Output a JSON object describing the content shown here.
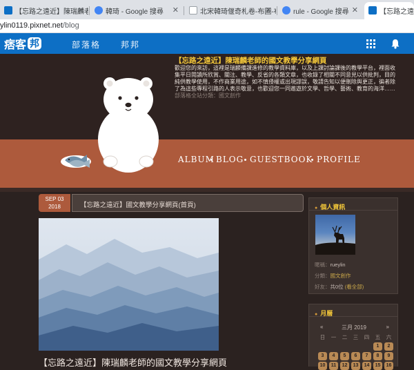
{
  "browser": {
    "tabs": [
      {
        "title": "【忘路之遠近】陳瑞麟老師的國文教學分",
        "active": false,
        "favicon_color": "#0d6fc5"
      },
      {
        "title": "韓琦 - Google 搜尋",
        "active": false,
        "favicon_color": "#4285f4"
      },
      {
        "title": "北宋韓琦偃奇札卷-布圖-布",
        "active": false,
        "favicon_color": "#9aa0a6"
      },
      {
        "title": "rule - Google 搜尋",
        "active": false,
        "favicon_color": "#4285f4"
      },
      {
        "title": "【忘路之遠",
        "active": true,
        "favicon_color": "#0d6fc5"
      }
    ],
    "address": {
      "host": "ylin0119.pixnet.net",
      "path": "/blog"
    }
  },
  "pixnet": {
    "logo_text": "痞客",
    "logo_mark": "邦",
    "nav": [
      "部落格",
      "邦邦"
    ],
    "icons": [
      "apps-grid-icon",
      "bell-icon"
    ]
  },
  "banner": {
    "title": "【忘路之遠近】陳瑞麟老師的國文教學分享網頁",
    "description": "歡迎您的來訪，這裡是瑞麟備課進修的教學資料庫，以及上課討論課後的教學平台，裡面收集平日閱讀所欣賞、關注、教學、反省的各類文章，也收錄了相關不同意見以供批判，目的純供教學使用，不作商業用途，如不慎侵權或出現謬誤，敬請告知以便刪除與更正，徧者除了為這些專程引路的人表示敬意，也歡迎您一同遨遊於文學、哲學、藝術、教育的海洋……",
    "category": "部落格全站分類：國文創作",
    "nav": [
      "ALBUM",
      "BLOG",
      "GUESTBOOK",
      "PROFILE"
    ],
    "colors": {
      "dark": "#2e2220",
      "band": "#ad5a3c",
      "accent": "#f5c93a"
    }
  },
  "post": {
    "date_line1": "SEP 03",
    "date_line2": "2018",
    "title": "【忘路之遠近】國文教學分享網頁(首頁)",
    "heading": "【忘路之遠近】陳瑞麟老師的國文教學分享網頁"
  },
  "sidebar": {
    "profile": {
      "heading": "個人資訊",
      "nick_label": "暱稱：",
      "nick_value": "ruey­lin",
      "cat_label": "分類：",
      "cat_value": "國文創作",
      "friends_label": "好友：",
      "friends_value": "共0位",
      "friends_link": "(看全部)"
    },
    "calendar": {
      "heading": "月曆",
      "month": "三月 2019",
      "prev": "«",
      "next": "»",
      "weekdays": [
        "日",
        "一",
        "二",
        "三",
        "四",
        "五",
        "六"
      ],
      "row1": [
        "1",
        "2"
      ],
      "row2": [
        "3",
        "4",
        "5",
        "6",
        "7",
        "8",
        "9"
      ],
      "row3": [
        "10",
        "11",
        "12",
        "13",
        "14",
        "15",
        "16"
      ]
    }
  }
}
